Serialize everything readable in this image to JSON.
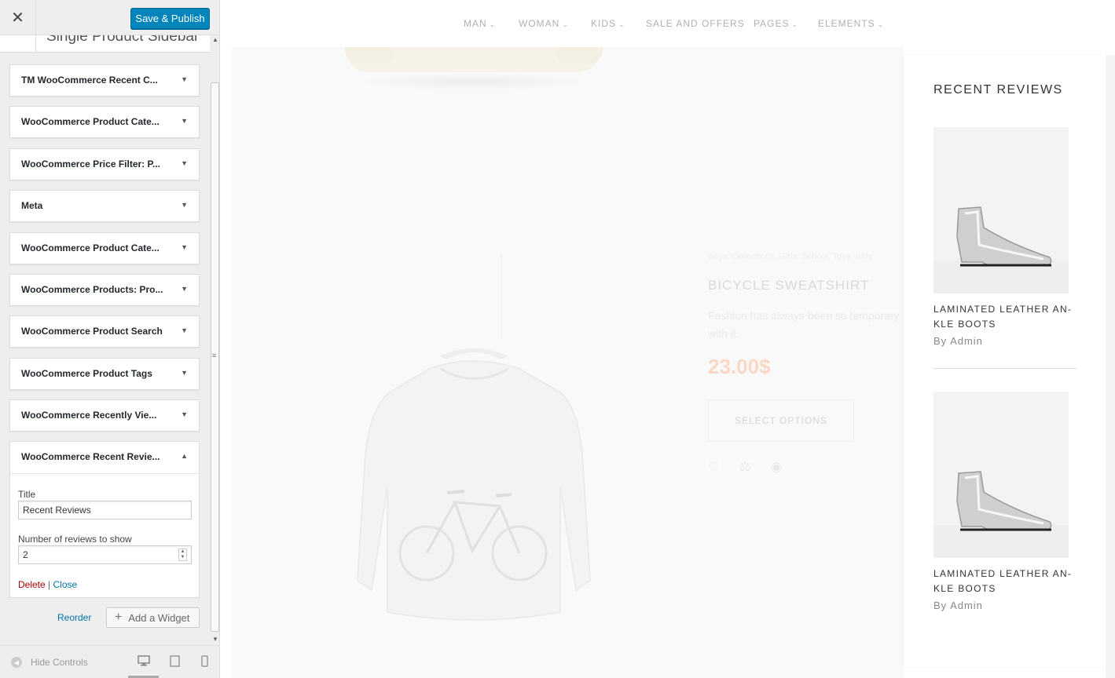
{
  "toolbar": {
    "close_glyph": "✕",
    "save_label": "Save & Publish"
  },
  "section": {
    "title": "Single Product Sidebar"
  },
  "widgets": [
    {
      "name": "TM WooCommerce Recent C...",
      "toggle_glyph": "▼"
    },
    {
      "name": "WooCommerce Product Cate...",
      "toggle_glyph": "▼"
    },
    {
      "name": "WooCommerce Price Filter: P...",
      "toggle_glyph": "▼"
    },
    {
      "name": "Meta",
      "toggle_glyph": "▼"
    },
    {
      "name": "WooCommerce Product Cate...",
      "toggle_glyph": "▼"
    },
    {
      "name": "WooCommerce Products: Pro...",
      "toggle_glyph": "▼"
    },
    {
      "name": "WooCommerce Product Search",
      "toggle_glyph": "▼"
    },
    {
      "name": "WooCommerce Product Tags",
      "toggle_glyph": "▼"
    },
    {
      "name": "WooCommerce Recently Vie...",
      "toggle_glyph": "▼"
    }
  ],
  "open_widget": {
    "name": "WooCommerce Recent Revie...",
    "toggle_glyph": "▲",
    "title_label": "Title",
    "title_value": "Recent Reviews",
    "count_label": "Number of reviews to show",
    "count_value": "2",
    "delete_label": "Delete",
    "separator": "|",
    "close_label": "Close"
  },
  "actions": {
    "reorder_label": "Reorder",
    "add_widget_label": "Add a Widget"
  },
  "footer": {
    "hide_controls_label": "Hide Controls"
  },
  "nav": {
    "items": [
      "MAN",
      "WOMAN",
      "KIDS",
      "SALE AND OFFERS",
      "PAGES",
      "ELEMENTS"
    ],
    "dropdowns": [
      true,
      true,
      true,
      false,
      true,
      true
    ]
  },
  "product": {
    "tags": "Boys, Collections, Girls, School, Toys, Kids",
    "title": "BICYCLE SWEATSHIRT",
    "description": "Fashion has always been so temporary with it.",
    "price": "23.00$",
    "button_label": "SELECT OPTIONS",
    "icons": [
      "heart-icon",
      "compare-icon",
      "eye-icon"
    ]
  },
  "reviews": {
    "heading": "RECENT REVIEWS",
    "items": [
      {
        "name": "LAMINATED LEATHER AN-KLE BOOTS",
        "author": "By Admin"
      },
      {
        "name": "LAMINATED LEATHER AN-KLE BOOTS",
        "author": "By Admin"
      }
    ]
  },
  "colors": {
    "primary_button": "#0085ba",
    "delete_link": "#aa0000",
    "link": "#0073aa",
    "price": "#fbd8c6"
  }
}
